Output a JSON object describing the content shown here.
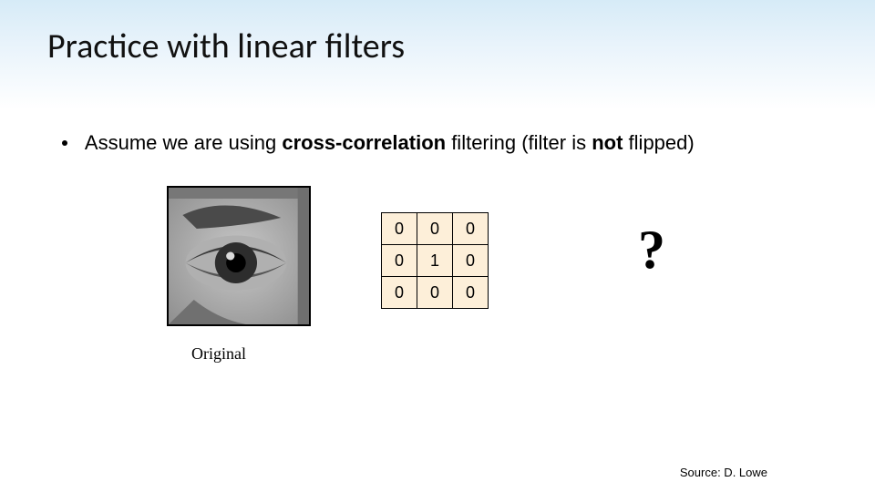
{
  "title": "Practice with linear filters",
  "bullet": {
    "prefix": "Assume we are using ",
    "bold1": "cross-correlation",
    "mid": " filtering (filter is ",
    "bold2": "not",
    "suffix": " flipped)"
  },
  "kernel": {
    "r0c0": "0",
    "r0c1": "0",
    "r0c2": "0",
    "r1c0": "0",
    "r1c1": "1",
    "r1c2": "0",
    "r2c0": "0",
    "r2c1": "0",
    "r2c2": "0"
  },
  "question": "?",
  "caption": "Original",
  "source": "Source: D. Lowe",
  "chart_data": {
    "type": "table",
    "title": "3x3 cross-correlation filter kernel",
    "rows": [
      [
        0,
        0,
        0
      ],
      [
        0,
        1,
        0
      ],
      [
        0,
        0,
        0
      ]
    ]
  }
}
